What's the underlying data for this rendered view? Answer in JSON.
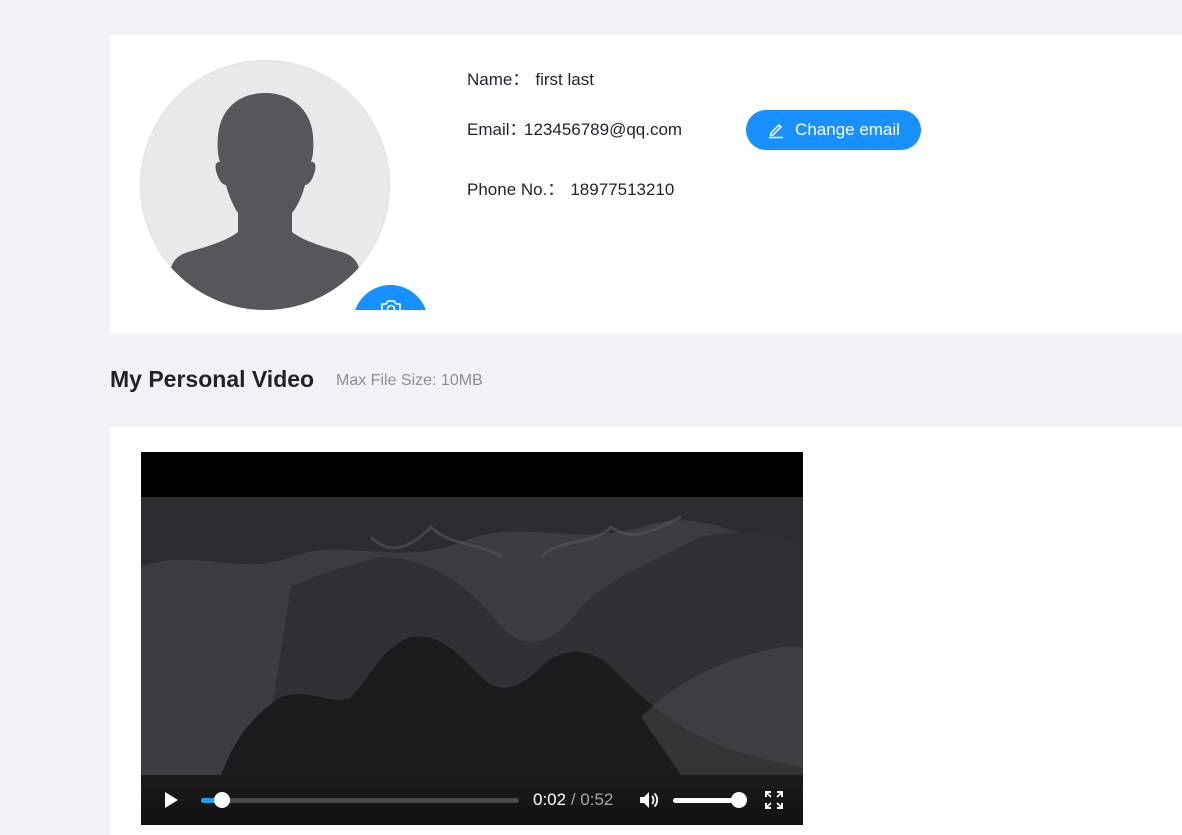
{
  "profile": {
    "name_label": "Name：",
    "name_value": "first last",
    "email_label": "Email：",
    "email_value": "123456789@qq.com",
    "change_email_label": "Change email",
    "phone_label": "Phone No.：",
    "phone_value": "18977513210",
    "avatar_icon": "user-silhouette-icon",
    "camera_icon": "camera-icon"
  },
  "video_section": {
    "title": "My Personal Video",
    "hint": "Max File Size: 10MB"
  },
  "video_player": {
    "current_time": "0:02",
    "separator": "/",
    "duration": "0:52",
    "progress": 0.067,
    "volume": 1.0,
    "icons": [
      "play-icon",
      "volume-icon",
      "fullscreen-icon"
    ]
  },
  "colors": {
    "accent": "#1890ff",
    "page_bg": "#f0f2f5",
    "progress": "#1ea0e8"
  }
}
